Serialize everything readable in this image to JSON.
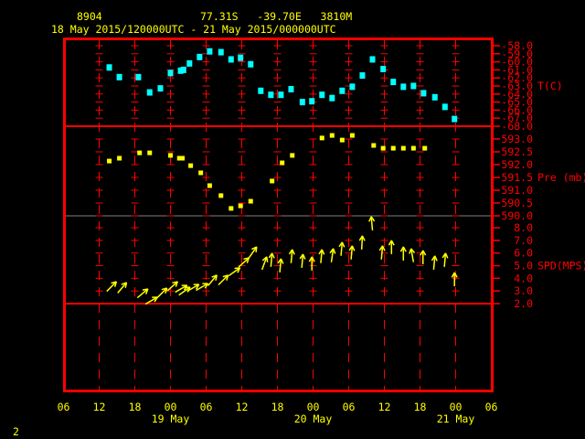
{
  "header": {
    "station": "8904",
    "location": "77.31S   -39.70E   3810M",
    "period": "18 May 2015/120000UTC - 21 May 2015/000000UTC"
  },
  "page_number": "2",
  "colors": {
    "frame": "#ff0000",
    "temperature": "#00ffff",
    "pressure": "#ffff00",
    "wind": "#ffff00",
    "text": "#ffff00",
    "divider": "#808080"
  },
  "chart_data": {
    "type": "scatter",
    "title": "8904  77.31S -39.70E 3810M",
    "xunit": "hours since 18 May 2015 06 UTC",
    "xlim": [
      0,
      72
    ],
    "x_tick_labels": [
      "06",
      "12",
      "18",
      "00",
      "06",
      "12",
      "18",
      "00",
      "06",
      "12",
      "18",
      "00",
      "06"
    ],
    "date_labels": [
      {
        "label": "19 May",
        "hour": 18
      },
      {
        "label": "20 May",
        "hour": 42
      },
      {
        "label": "21 May",
        "hour": 66
      }
    ],
    "panels": [
      {
        "name": "temperature",
        "label": "T(C)",
        "ylim": [
          -68,
          -58
        ],
        "ticks": [
          "-58.0",
          "-59.0",
          "-60.0",
          "-61.0",
          "-62.0",
          "-63.0",
          "-64.0",
          "-65.0",
          "-66.0",
          "-67.0",
          "-68.0"
        ],
        "points": [
          [
            7.7,
            -60.7
          ],
          [
            9.4,
            -61.9
          ],
          [
            12.6,
            -61.9
          ],
          [
            14.5,
            -63.8
          ],
          [
            16.3,
            -63.3
          ],
          [
            18.0,
            -61.4
          ],
          [
            19.7,
            -61.1
          ],
          [
            20.2,
            -61.0
          ],
          [
            21.2,
            -60.2
          ],
          [
            22.9,
            -59.4
          ],
          [
            24.6,
            -58.7
          ],
          [
            26.5,
            -58.8
          ],
          [
            28.2,
            -59.7
          ],
          [
            29.8,
            -59.5
          ],
          [
            31.5,
            -60.3
          ],
          [
            33.2,
            -63.6
          ],
          [
            34.9,
            -64.1
          ],
          [
            36.6,
            -64.1
          ],
          [
            38.3,
            -63.4
          ],
          [
            40.2,
            -65.0
          ],
          [
            41.8,
            -64.9
          ],
          [
            43.5,
            -64.1
          ],
          [
            45.2,
            -64.5
          ],
          [
            46.9,
            -63.6
          ],
          [
            48.6,
            -63.1
          ],
          [
            50.3,
            -61.7
          ],
          [
            52.0,
            -59.7
          ],
          [
            53.8,
            -60.9
          ],
          [
            55.5,
            -62.5
          ],
          [
            57.2,
            -63.1
          ],
          [
            58.9,
            -63.0
          ],
          [
            60.6,
            -63.9
          ],
          [
            62.5,
            -64.4
          ],
          [
            64.2,
            -65.6
          ],
          [
            65.8,
            -67.1
          ]
        ]
      },
      {
        "name": "pressure",
        "label": "Pre (mb)",
        "ylim": [
          590,
          593
        ],
        "ticks": [
          "593.0",
          "592.5",
          "592.0",
          "591.5",
          "591.0",
          "590.5",
          "590.0"
        ],
        "points": [
          [
            7.7,
            592.14
          ],
          [
            9.4,
            592.25
          ],
          [
            12.8,
            592.46
          ],
          [
            14.5,
            592.46
          ],
          [
            18.0,
            592.36
          ],
          [
            19.5,
            592.25
          ],
          [
            20.0,
            592.25
          ],
          [
            21.4,
            591.96
          ],
          [
            23.1,
            591.68
          ],
          [
            24.6,
            591.18
          ],
          [
            26.5,
            590.79
          ],
          [
            28.2,
            590.29
          ],
          [
            29.8,
            590.39
          ],
          [
            31.5,
            590.57
          ],
          [
            35.1,
            591.36
          ],
          [
            36.8,
            592.07
          ],
          [
            38.5,
            592.36
          ],
          [
            43.5,
            593.04
          ],
          [
            45.2,
            593.14
          ],
          [
            46.9,
            592.96
          ],
          [
            48.6,
            593.14
          ],
          [
            52.2,
            592.75
          ],
          [
            53.8,
            592.64
          ],
          [
            55.5,
            592.64
          ],
          [
            57.2,
            592.64
          ],
          [
            58.9,
            592.64
          ],
          [
            60.8,
            592.64
          ]
        ]
      },
      {
        "name": "wind",
        "label": "SPD(MPS)",
        "ylim": [
          2,
          8
        ],
        "ticks": [
          "8.0",
          "7.0",
          "6.0",
          "5.0",
          "4.0",
          "3.0",
          "2.0"
        ],
        "value_format": "[hour, speed_mps, direction_toward_deg]",
        "points": [
          [
            8.9,
            3.74,
            45
          ],
          [
            10.6,
            3.67,
            40
          ],
          [
            14.2,
            3.16,
            50
          ],
          [
            15.8,
            2.51,
            60
          ],
          [
            17.4,
            3.23,
            45
          ],
          [
            19.2,
            3.74,
            48
          ],
          [
            20.8,
            3.45,
            60
          ],
          [
            21.3,
            3.3,
            55
          ],
          [
            22.8,
            3.52,
            60
          ],
          [
            24.3,
            3.59,
            60
          ],
          [
            25.8,
            4.25,
            40
          ],
          [
            27.7,
            4.25,
            45
          ],
          [
            29.7,
            4.83,
            55
          ],
          [
            31.2,
            5.62,
            48
          ],
          [
            32.5,
            6.49,
            35
          ],
          [
            34.2,
            5.7,
            20
          ],
          [
            35.1,
            5.99,
            5
          ],
          [
            36.6,
            5.55,
            5
          ],
          [
            38.5,
            6.28,
            5
          ],
          [
            40.3,
            5.91,
            5
          ],
          [
            41.8,
            5.7,
            0
          ],
          [
            43.5,
            6.28,
            5
          ],
          [
            45.4,
            6.35,
            8
          ],
          [
            46.9,
            6.86,
            5
          ],
          [
            48.6,
            6.57,
            5
          ],
          [
            50.3,
            7.36,
            3
          ],
          [
            51.8,
            8.88,
            -5
          ],
          [
            53.7,
            6.57,
            5
          ],
          [
            55.2,
            7.0,
            0
          ],
          [
            57.2,
            6.49,
            0
          ],
          [
            58.5,
            6.35,
            -10
          ],
          [
            60.5,
            6.2,
            0
          ],
          [
            62.5,
            5.77,
            5
          ],
          [
            64.3,
            5.99,
            5
          ],
          [
            65.8,
            4.46,
            0
          ]
        ]
      }
    ]
  }
}
